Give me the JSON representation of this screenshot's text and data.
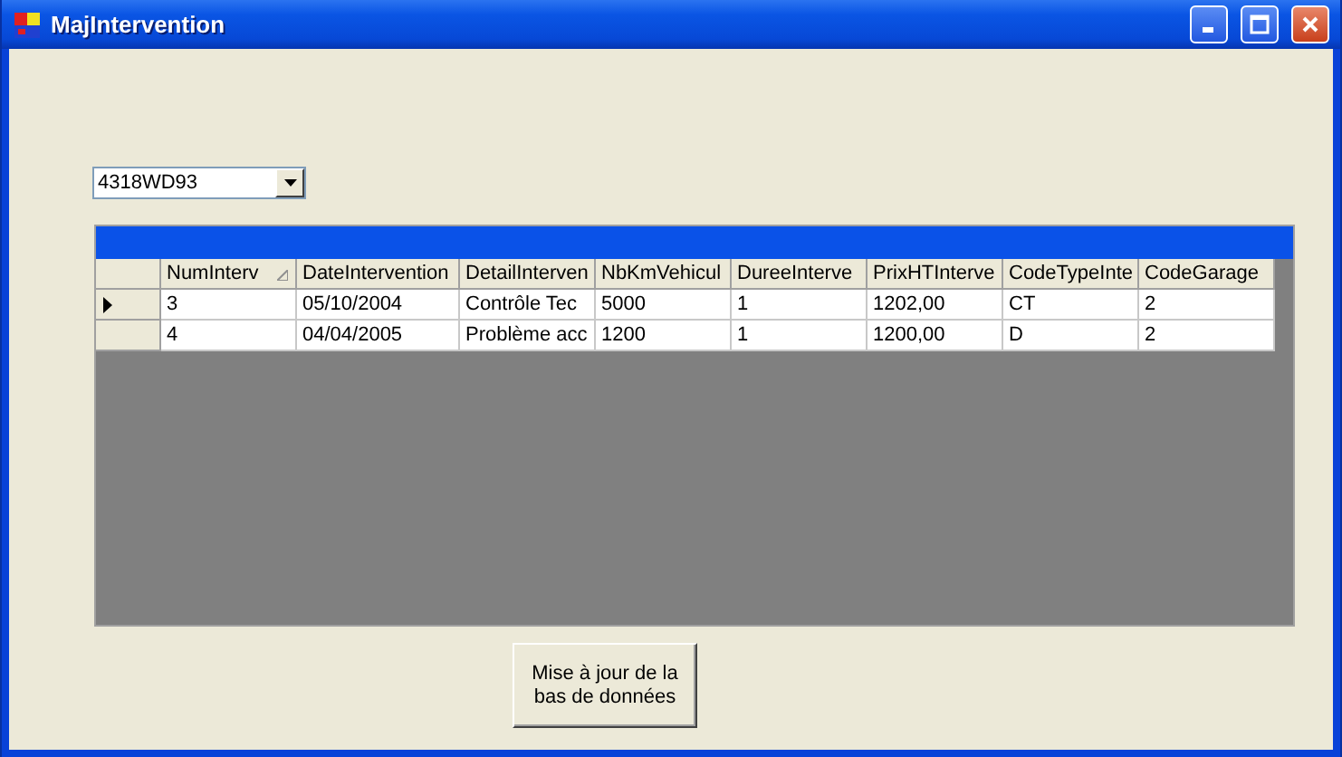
{
  "window": {
    "title": "MajIntervention"
  },
  "vehicle_combo": {
    "value": "4318WD93"
  },
  "grid": {
    "columns": [
      {
        "label": "NumInterv",
        "sorted": true
      },
      {
        "label": "DateIntervention",
        "sorted": false
      },
      {
        "label": "DetailInterven",
        "sorted": false
      },
      {
        "label": "NbKmVehicul",
        "sorted": false
      },
      {
        "label": "DureeInterve",
        "sorted": false
      },
      {
        "label": "PrixHTInterve",
        "sorted": false
      },
      {
        "label": "CodeTypeInte",
        "sorted": false
      },
      {
        "label": "CodeGarage",
        "sorted": false
      }
    ],
    "rows": [
      {
        "current": true,
        "cells": [
          "3",
          "05/10/2004",
          "Contrôle Tec",
          "5000",
          "1",
          "1202,00",
          "CT",
          "2"
        ]
      },
      {
        "current": false,
        "cells": [
          "4",
          "04/04/2005",
          "Problème acc",
          "1200",
          "1",
          "1200,00",
          "D",
          "2"
        ]
      }
    ]
  },
  "update_button": {
    "label": "Mise à jour de la bas de données"
  }
}
